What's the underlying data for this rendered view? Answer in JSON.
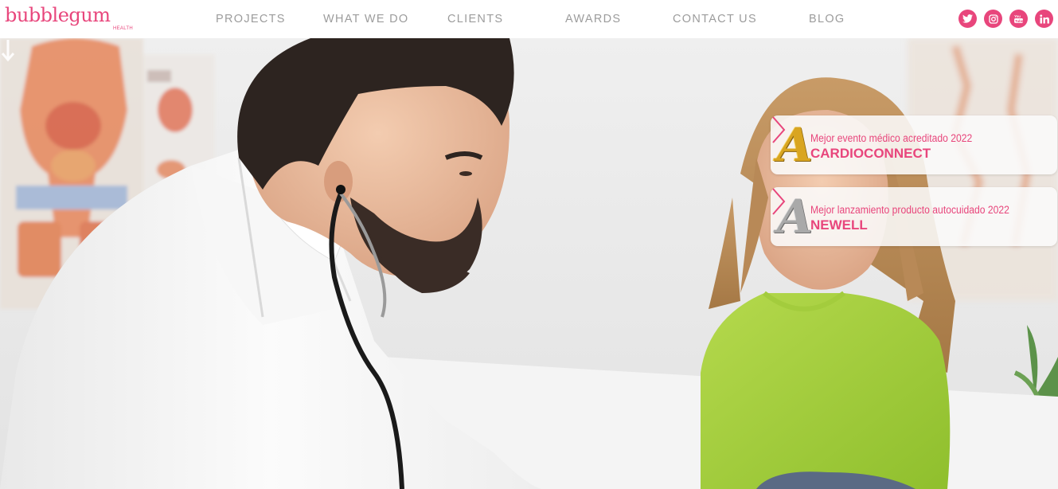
{
  "brand": {
    "name": "bubblegum",
    "sub": "HEALTH"
  },
  "nav": {
    "items": [
      {
        "label": "PROJECTS"
      },
      {
        "label": "WHAT WE DO"
      },
      {
        "label": "CLIENTS"
      },
      {
        "label": "AWARDS"
      },
      {
        "label": "CONTACT US"
      },
      {
        "label": "BLOG"
      }
    ]
  },
  "social": [
    {
      "icon": "twitter-icon"
    },
    {
      "icon": "instagram-icon"
    },
    {
      "icon": "youtube-icon"
    },
    {
      "icon": "linkedin-icon"
    }
  ],
  "awards": [
    {
      "subtitle": "Mejor evento médico acreditado 2022",
      "title": "CARDIOCONNECT",
      "badge": "gold"
    },
    {
      "subtitle": "Mejor lanzamiento producto autocuidado 2022",
      "title": "NEWELL",
      "badge": "silver"
    }
  ],
  "colors": {
    "accent": "#e8467c",
    "nav_text": "#9c9c9c",
    "badge_gold": "#d9a520",
    "badge_silver": "#a9a9a9"
  },
  "icons": {
    "scroll": "arrow-down-icon",
    "award_next": "chevron-right-icon"
  }
}
